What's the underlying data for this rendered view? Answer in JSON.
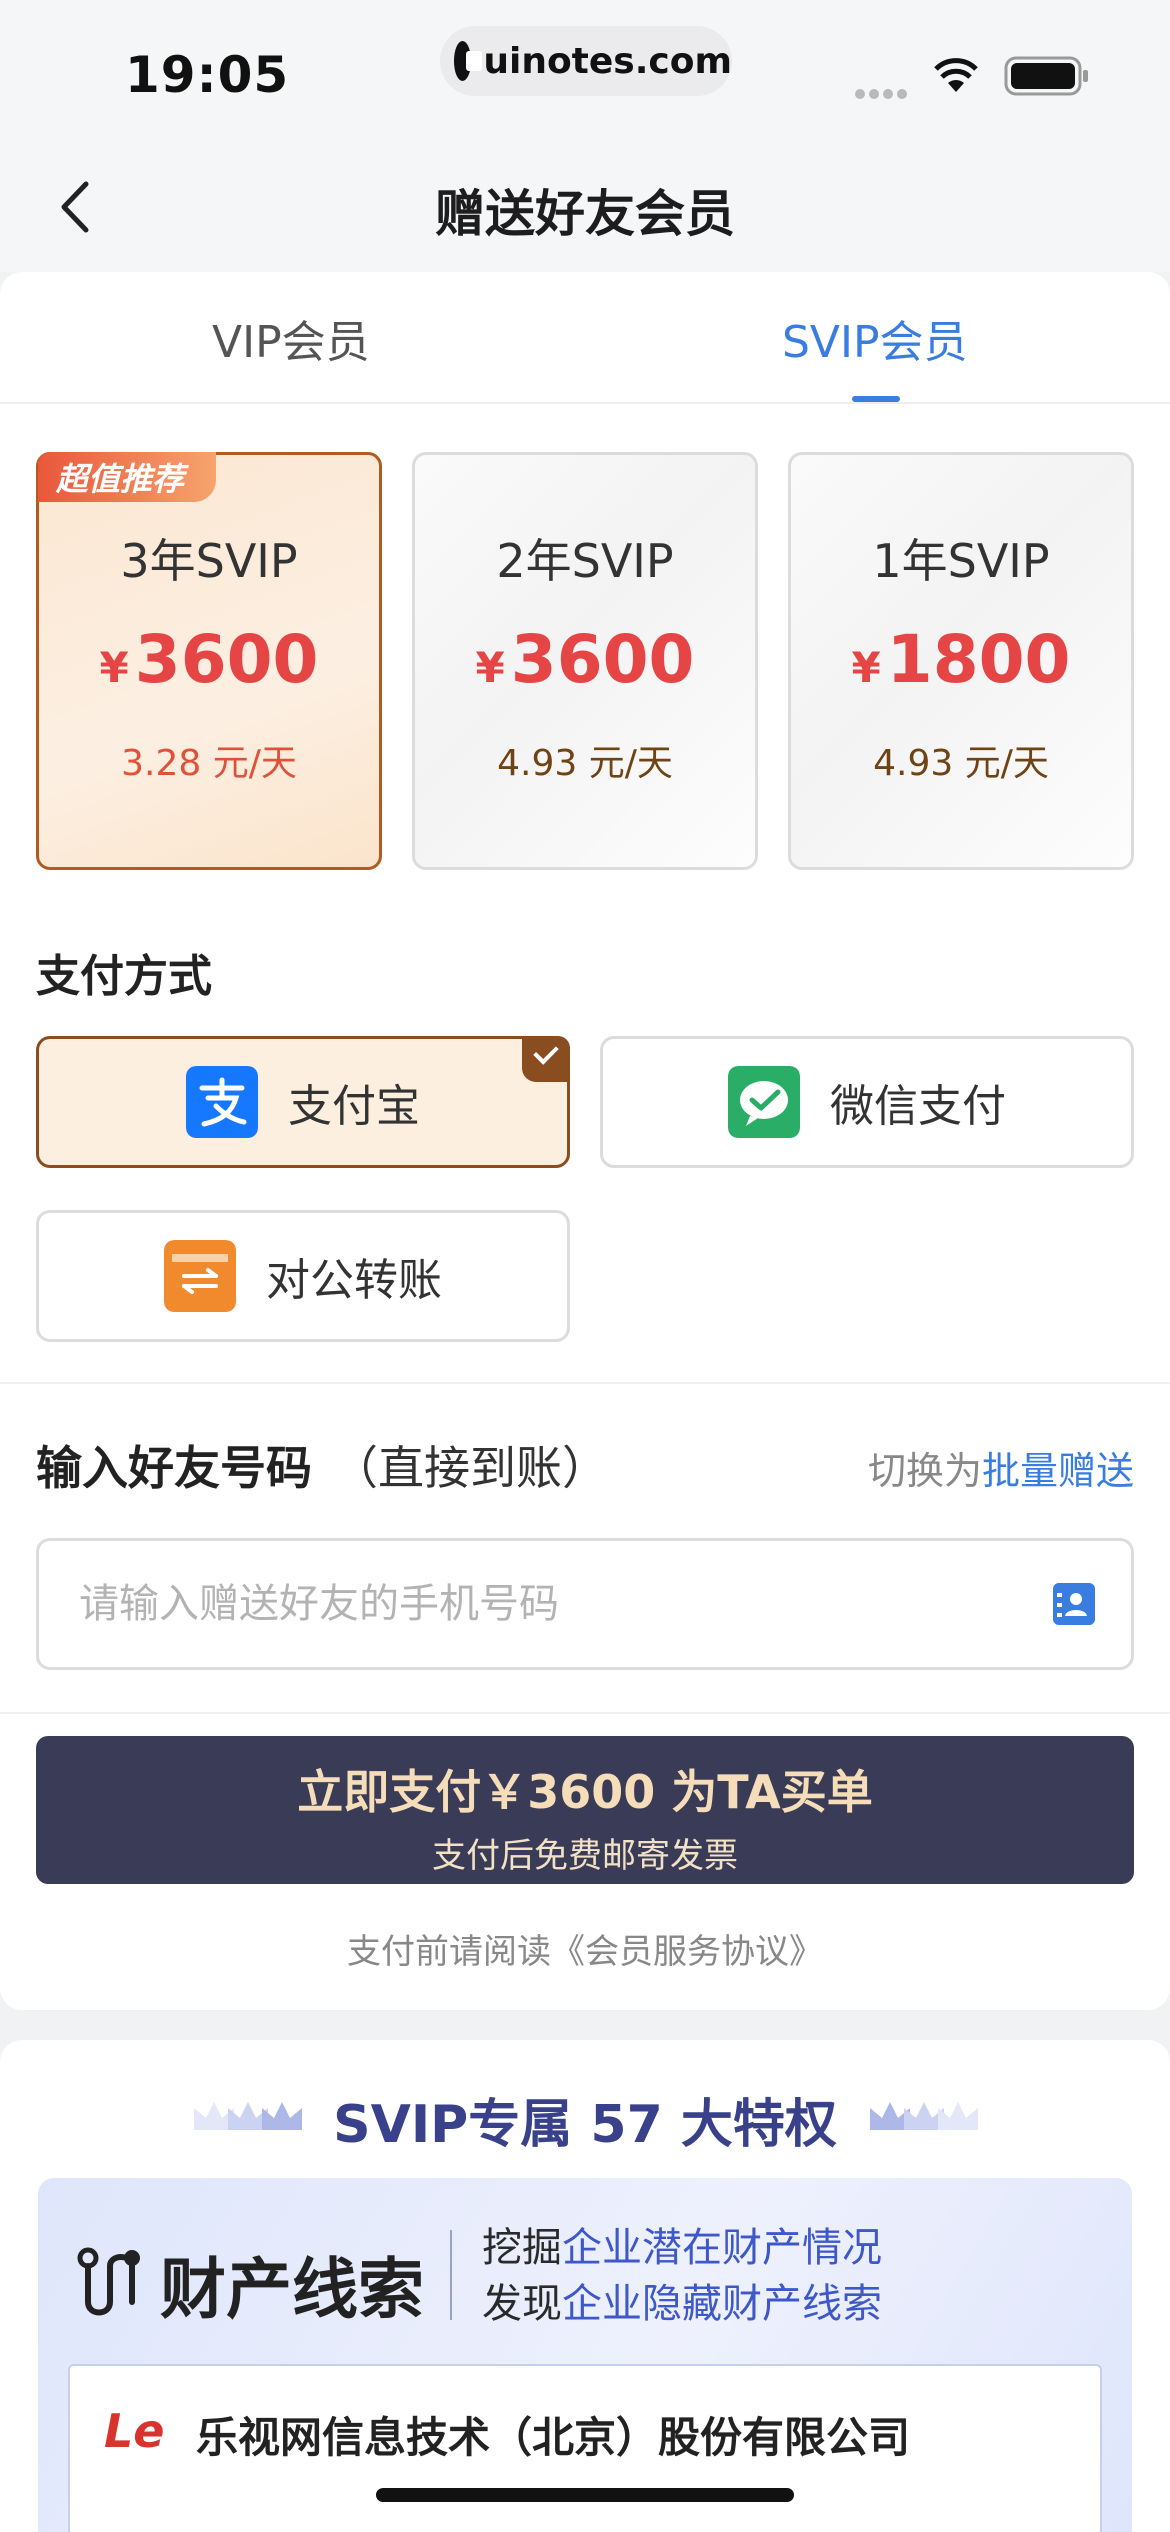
{
  "status_bar": {
    "time": "19:05",
    "url": "uinotes.com"
  },
  "nav": {
    "title": "赠送好友会员"
  },
  "tabs": [
    {
      "label": "VIP会员",
      "active": false
    },
    {
      "label": "SVIP会员",
      "active": true
    }
  ],
  "plans": {
    "badge": "超值推荐",
    "items": [
      {
        "name": "3年SVIP",
        "currency": "¥",
        "price": "3600",
        "daily": "3.28 元/天",
        "selected": true
      },
      {
        "name": "2年SVIP",
        "currency": "¥",
        "price": "3600",
        "daily": "4.93 元/天",
        "selected": false
      },
      {
        "name": "1年SVIP",
        "currency": "¥",
        "price": "1800",
        "daily": "4.93 元/天",
        "selected": false
      }
    ]
  },
  "payment": {
    "heading": "支付方式",
    "methods": [
      {
        "label": "支付宝",
        "icon": "alipay-icon",
        "color": "#1677ff",
        "selected": true
      },
      {
        "label": "微信支付",
        "icon": "wechat-pay-icon",
        "color": "#2aae67",
        "selected": false
      },
      {
        "label": "对公转账",
        "icon": "bank-transfer-icon",
        "color": "#f08a2c",
        "selected": false
      }
    ]
  },
  "friend": {
    "heading": "输入好友号码",
    "heading_note": "（直接到账）",
    "switch_prefix": "切换为",
    "switch_link": "批量赠送",
    "phone_placeholder": "请输入赠送好友的手机号码",
    "phone_value": ""
  },
  "pay_button": {
    "line1": "立即支付￥3600 为TA买单",
    "line2": "支付后免费邮寄发票"
  },
  "agreement": "支付前请阅读《会员服务协议》",
  "privileges": {
    "title": "SVIP专属 57 大特权",
    "feature_title": "财产线索",
    "desc_line1_plain": "挖掘",
    "desc_line1_link": "企业潜在财产情况",
    "desc_line2_plain": "发现",
    "desc_line2_link": "企业隐藏财产线索",
    "company_logo": "Le",
    "company_name": "乐视网信息技术（北京）股份有限公司"
  },
  "colors": {
    "accent": "#3a7de0",
    "price": "#e64545",
    "button": "#3a3b57",
    "brand_title": "#39418a"
  }
}
